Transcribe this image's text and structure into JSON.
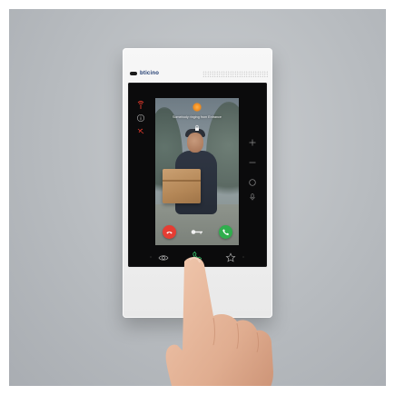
{
  "device": {
    "brand": "bticino",
    "screen": {
      "call_text": "Somebody ringing from Entrance",
      "indicator_color": "#f28a1d"
    },
    "left_keys": [
      "antenna-icon",
      "info-icon",
      "phone-off-icon"
    ],
    "right_keys": [
      "plus-icon",
      "minus-icon",
      "circle-icon",
      "mic-icon"
    ],
    "bottom_keys": [
      "eye-icon",
      "handset-icon",
      "star-icon"
    ],
    "colors": {
      "reject": "#e53d33",
      "accept": "#2fae4d",
      "handset_highlight": "#37c16a"
    }
  }
}
